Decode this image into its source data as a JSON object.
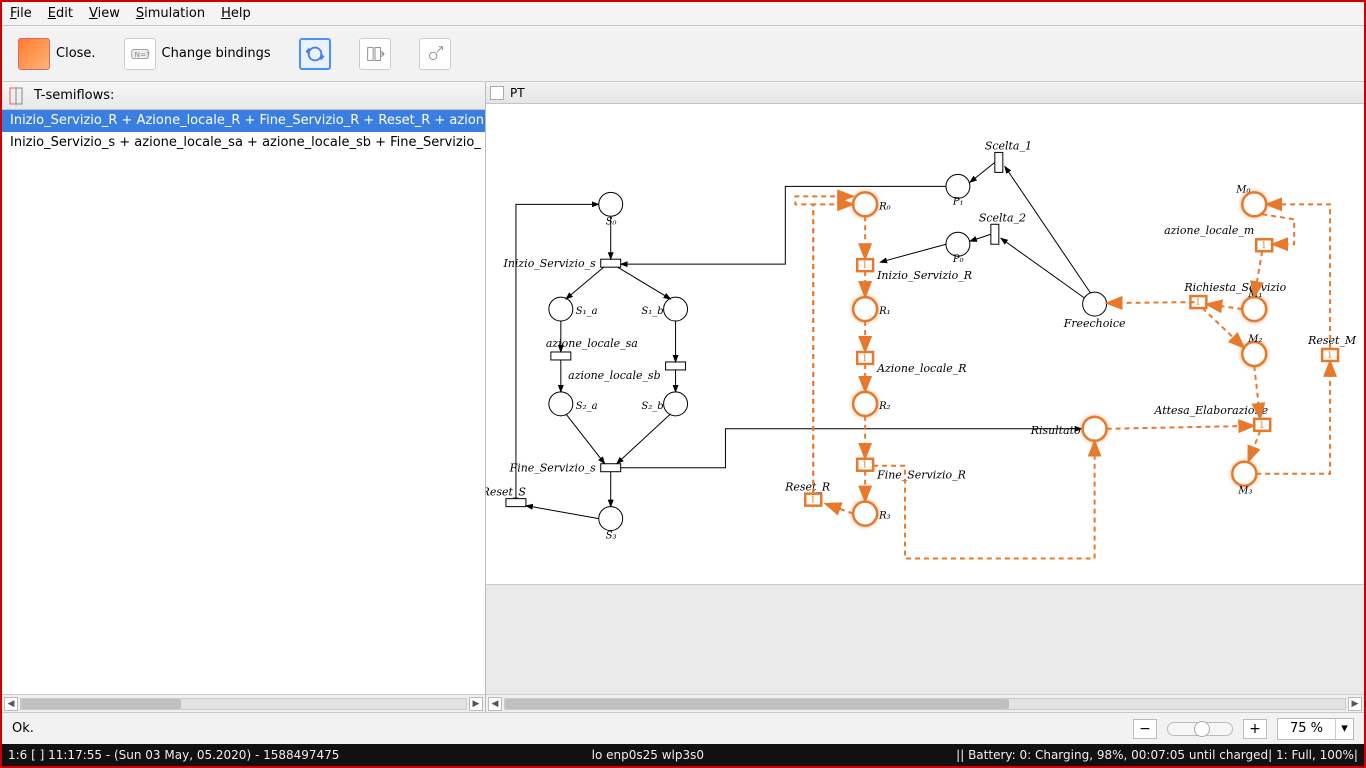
{
  "menu": {
    "items": [
      "File",
      "Edit",
      "View",
      "Simulation",
      "Help"
    ]
  },
  "toolbar": {
    "close": "Close.",
    "change_bindings": "Change bindings"
  },
  "left": {
    "title": "T-semiflows:",
    "rows": [
      "Inizio_Servizio_R + Azione_locale_R + Fine_Servizio_R + Reset_R + azion",
      "Inizio_Servizio_s + azione_locale_sa + azione_locale_sb + Fine_Servizio_"
    ],
    "selected_index": 0
  },
  "right": {
    "tab": "PT"
  },
  "net": {
    "places": {
      "S0": "S₀",
      "S1a": "S₁_a",
      "S1b": "S₁_b",
      "S2a": "S₂_a",
      "S2b": "S₂_b",
      "S3": "S₃",
      "R0": "R₀",
      "R1": "R₁",
      "R2": "R₂",
      "R3": "R₃",
      "P0": "P₀",
      "P1": "P₁",
      "M0": "M₀",
      "M1": "M₁",
      "M2": "M₂",
      "M3": "M₃",
      "Freechoice": "Freechoice",
      "Risultato": "Risultato"
    },
    "transitions": {
      "Inizio_Servizio_s": "Inizio_Servizio_s",
      "azione_locale_sa": "azione_locale_sa",
      "azione_locale_sb": "azione_locale_sb",
      "Fine_Servizio_s": "Fine_Servizio_s",
      "Reset_S": "Reset_S",
      "Scelta_1": "Scelta_1",
      "Scelta_2": "Scelta_2",
      "Inizio_Servizio_R": "Inizio_Servizio_R",
      "Azione_locale_R": "Azione_locale_R",
      "Fine_Servizio_R": "Fine_Servizio_R",
      "Reset_R": "Reset_R",
      "azione_locale_m": "azione_locale_m",
      "Richiesta_Servizio": "Richiesta_Servizio",
      "Attesa_Elaborazione": "Attesa_Elaborazione",
      "Reset_M": "Reset_M"
    }
  },
  "status": {
    "text": "Ok.",
    "zoom": "75 %"
  },
  "taskbar": {
    "left": "1:6 [ ]    11:17:55 - (Sun 03 May, 05.2020) - 1588497475",
    "center": "lo enp0s25 wlp3s0",
    "right": "||   Battery: 0: Charging, 98%, 00:07:05 until charged| 1: Full, 100%|"
  }
}
